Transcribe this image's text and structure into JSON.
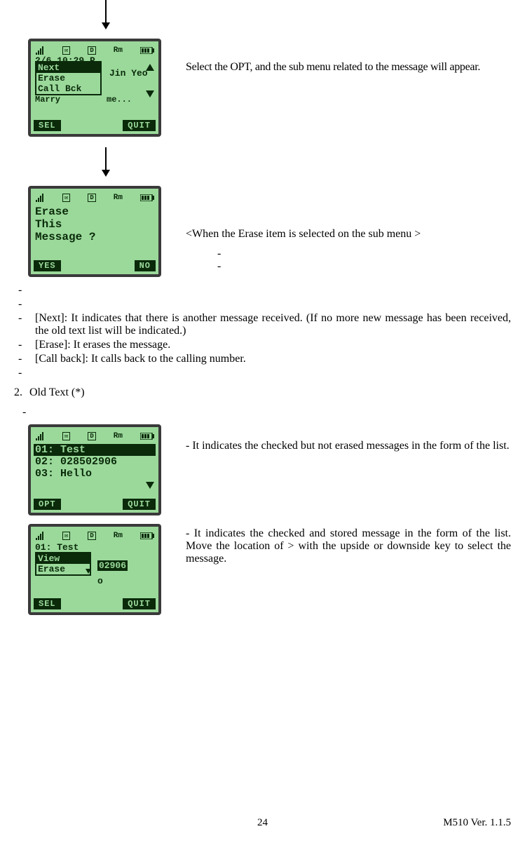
{
  "footer": {
    "page": "24",
    "version": "M510    Ver. 1.1.5"
  },
  "section2": {
    "num": "2.",
    "title": "Old Text (*)"
  },
  "desc": {
    "screen1": "Select the OPT, and the sub menu related to the message will appear.",
    "screen2": "<When the Erase item is selected on the sub menu >",
    "screen3": "- It indicates the checked but not erased messages in the form of the list.",
    "screen4": "- It indicates the checked and stored message in the form of the list. Move the location of > with the upside or downside key to select the message."
  },
  "bullets": {
    "next": "[Next]: It indicates that there is another message received. (If no more new message has been received, the old text list will be indicated.)",
    "erase": "[Erase]: It erases the message.",
    "callback": "[Call back]: It calls back to the calling number."
  },
  "screen1": {
    "datetime": "2/6 10:29 P",
    "behind": "Jin Yeo",
    "behind2": "me...",
    "menu": {
      "next": "Next",
      "erase": "Erase",
      "callbck": "Call Bck"
    },
    "icons": {
      "env": "✉",
      "d": "D",
      "rm": "Rm"
    },
    "soft": {
      "left": "SEL",
      "right": "QUIT"
    }
  },
  "screen2": {
    "line1": "Erase",
    "line2": "This",
    "line3": "Message ?",
    "icons": {
      "env": "✉",
      "d": "D",
      "rm": "Rm"
    },
    "soft": {
      "left": "YES",
      "right": "NO"
    }
  },
  "screen3": {
    "r1": "01: Test",
    "r2": "02: 028502906",
    "r3": "03: Hello",
    "icons": {
      "env": "✉",
      "d": "D",
      "rm": "Rm"
    },
    "soft": {
      "left": "OPT",
      "right": "QUIT"
    }
  },
  "screen4": {
    "partial1": "01: Test",
    "partial_mid": "02906",
    "partial_lo": "o",
    "menu": {
      "view": "View",
      "erase": "Erase"
    },
    "icons": {
      "env": "✉",
      "d": "D",
      "rm": "Rm"
    },
    "soft": {
      "left": "SEL",
      "right": "QUIT"
    }
  }
}
